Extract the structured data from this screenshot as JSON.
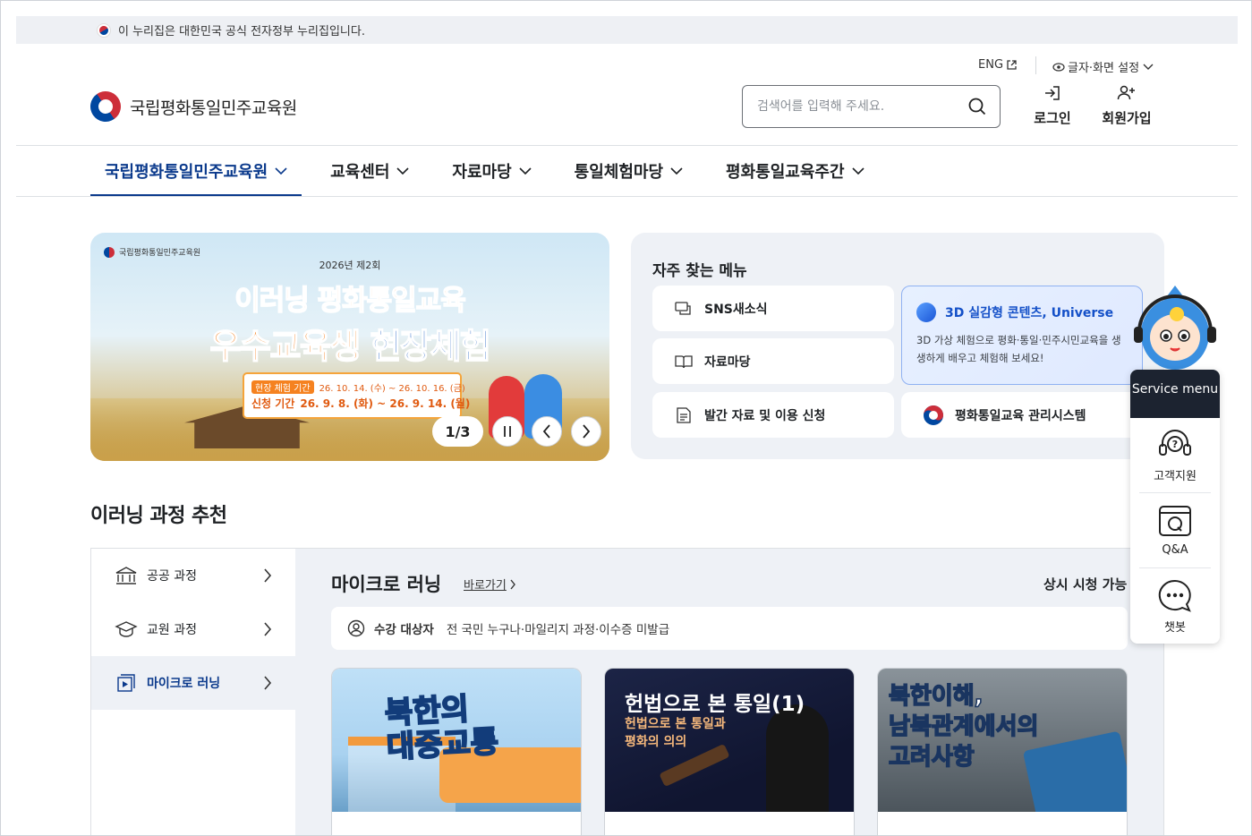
{
  "gov_bar": {
    "text": "이 누리집은 대한민국 공식 전자정부 누리집입니다."
  },
  "utility": {
    "eng": "ENG",
    "display_settings": "글자·화면 설정"
  },
  "logo": {
    "name": "국립평화통일민주교육원"
  },
  "search": {
    "placeholder": "검색어를 입력해 주세요."
  },
  "auth": {
    "login": "로그인",
    "signup": "회원가입"
  },
  "gnb": {
    "items": [
      "국립평화통일민주교육원",
      "교육센터",
      "자료마당",
      "통일체험마당",
      "평화통일교육주간"
    ]
  },
  "banner": {
    "logo_text": "국립평화통일민주교육원",
    "year": "2026년 제2회",
    "title1": "이러닝 평화통일교육",
    "title2a": "우수교육생",
    "title2b": "현장체험",
    "info1_label": "현장 체험 기간",
    "info1_value": "26. 10. 14. (수) ~ 26. 10. 16. (금)",
    "info2_label": "신청 기간",
    "info2_value": "26. 9. 8. (화) ~ 26. 9. 14. (월)",
    "pager": "1/3"
  },
  "favorites": {
    "title": "자주 찾는 메뉴",
    "items": [
      "SNS새소식",
      "자료마당",
      "발간 자료 및 이용 신청",
      "평화통일교육 관리시스템"
    ],
    "highlight_title": "3D 실감형 콘텐츠, Universe",
    "highlight_desc": "3D 가상 체험으로 평화·통일·민주시민교육을 생생하게 배우고 체험해 보세요!"
  },
  "elearning": {
    "section_title": "이러닝 과정 추천",
    "categories": [
      "공공 과정",
      "교원 과정",
      "마이크로 러닝"
    ],
    "micro_title": "마이크로 러닝",
    "shortcut": "바로가기",
    "always": "상시 시청 가능",
    "target_label": "수강 대상자",
    "target_value": "전 국민 누구나·마일리지 과정·이수증 미발급",
    "cards": [
      {
        "l1": "북한의",
        "l2": "대중교통"
      },
      {
        "l1": "헌법으로 본 통일(1)",
        "l2": "헌법으로 본 통일과",
        "l3": "평화의 의의"
      },
      {
        "l1": "북한이해,",
        "l2": "남북관계에서의",
        "l3": "고려사항"
      }
    ]
  },
  "service_menu": {
    "title": "Service menu",
    "items": [
      "고객지원",
      "Q&A",
      "챗봇"
    ]
  },
  "colors": {
    "primary": "#0b3a8c",
    "accent_orange": "#f58220",
    "highlight_blue": "#1450c8"
  }
}
